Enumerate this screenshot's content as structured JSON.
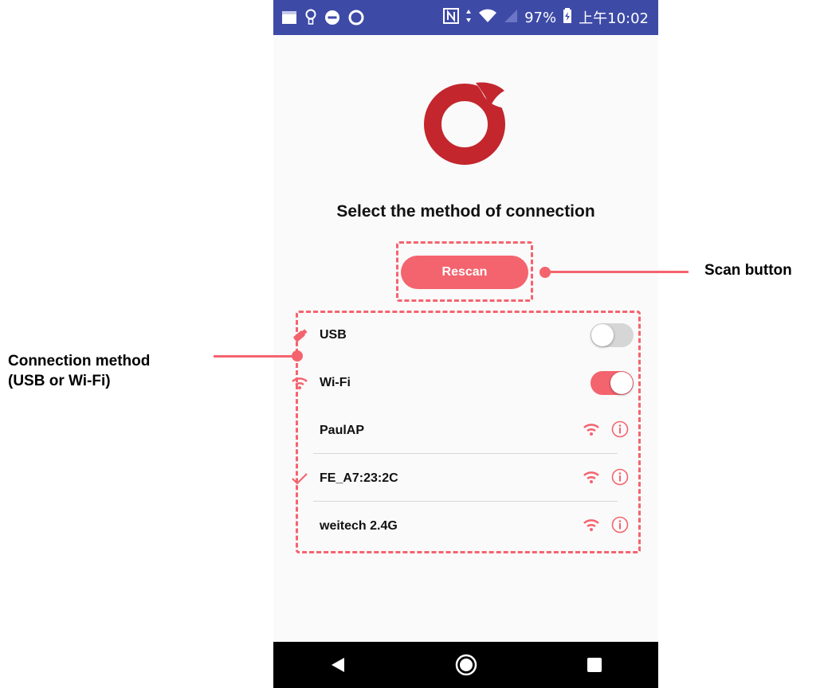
{
  "status_bar": {
    "battery": "97%",
    "time": "上午10:02",
    "icons": [
      "window-icon",
      "lightbulb-icon",
      "do-not-disturb-icon",
      "circle-icon",
      "nfc-icon",
      "data-arrows-icon",
      "wifi-icon",
      "signal-icon",
      "battery-icon"
    ]
  },
  "app": {
    "title": "Select the method of connection",
    "rescan_label": "Rescan",
    "accent_color": "#f4646e",
    "logo_color": "#c3262d"
  },
  "connections": {
    "usb": {
      "label": "USB",
      "enabled": false,
      "icon": "usb-drive-icon"
    },
    "wifi": {
      "label": "Wi-Fi",
      "enabled": true,
      "icon": "wifi-icon"
    }
  },
  "networks": [
    {
      "ssid": "PaulAP",
      "selected": false
    },
    {
      "ssid": "FE_A7:23:2C",
      "selected": true
    },
    {
      "ssid": "weitech 2.4G",
      "selected": false
    }
  ],
  "nav_bar": {
    "icons": [
      "back-icon",
      "home-icon",
      "recents-icon"
    ]
  },
  "annotations": {
    "scan_button": "Scan button",
    "connection_method_line1": "Connection method",
    "connection_method_line2": "(USB or Wi-Fi)"
  }
}
